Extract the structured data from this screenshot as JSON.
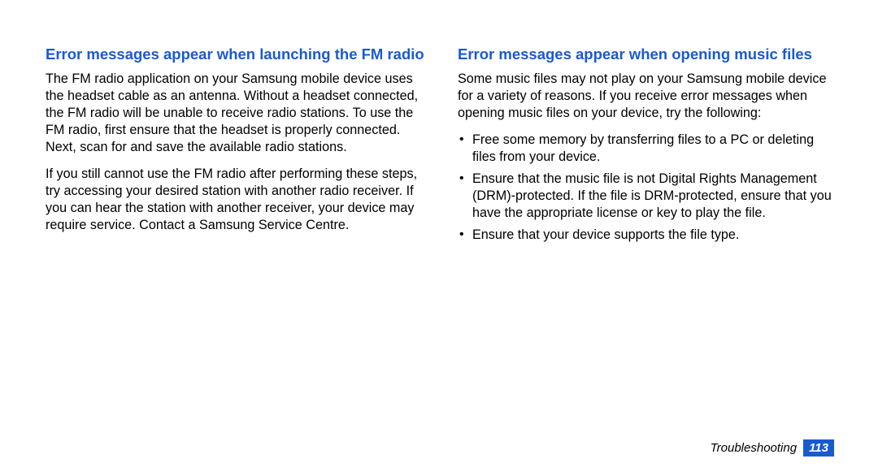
{
  "left": {
    "heading": "Error messages appear when launching the FM radio",
    "p1": "The FM radio application on your Samsung mobile device uses the headset cable as an antenna. Without a headset connected, the FM radio will be unable to receive radio stations. To use the FM radio, first ensure that the headset is properly connected. Next, scan for and save the available radio stations.",
    "p2": "If you still cannot use the FM radio after performing these steps, try accessing your desired station with another radio receiver. If you can hear the station with another receiver, your device may require service. Contact a Samsung Service Centre."
  },
  "right": {
    "heading": "Error messages appear when opening music files",
    "intro": "Some music files may not play on your Samsung mobile device for a variety of reasons. If you receive error messages when opening music files on your device, try the following:",
    "bullets": [
      "Free some memory by transferring files to a PC or deleting files from your device.",
      "Ensure that the music file is not Digital Rights Management (DRM)-protected. If the file is DRM-protected, ensure that you have the appropriate license or key to play the file.",
      "Ensure that your device supports the file type."
    ]
  },
  "footer": {
    "section": "Troubleshooting",
    "page": "113"
  }
}
